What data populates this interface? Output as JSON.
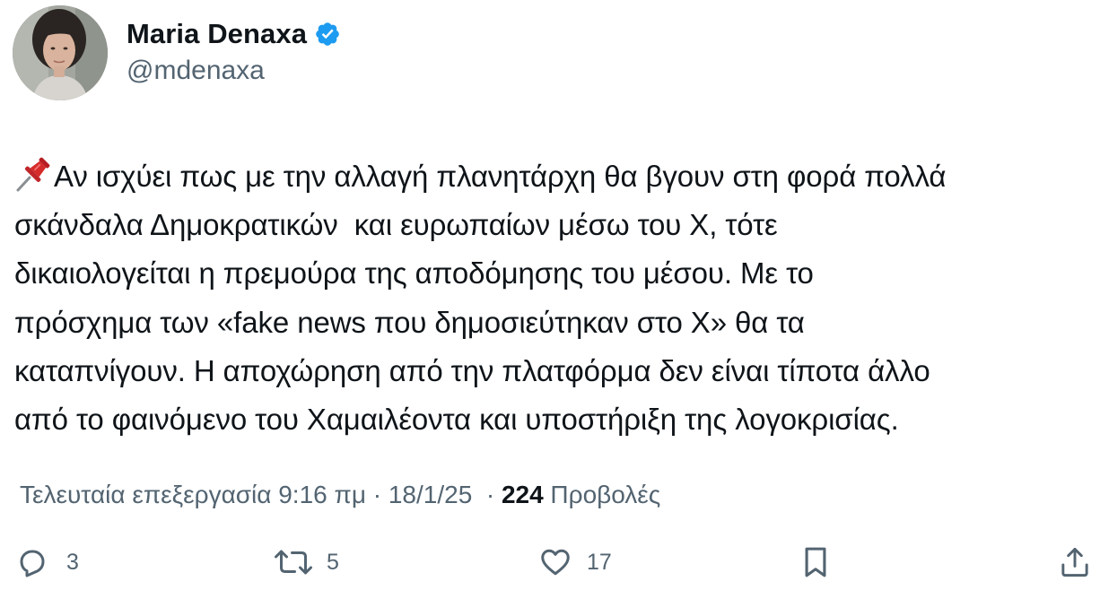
{
  "author": {
    "display_name": "Maria Denaxa",
    "handle": "@mdenaxa",
    "verified_color": "#1d9bf0"
  },
  "tweet": {
    "pin_icon": "pushpin-icon",
    "text": "Αν ισχύει πως με την αλλαγή πλανητάρχη θα βγουν στη φορά πολλά σκάνδαλα Δημοκρατικών  και ευρωπαίων μέσω του Χ, τότε δικαιολογείται η πρεμούρα της αποδόμησης του μέσου. Με το πρόσχημα των «fake news που δημοσιεύτηκαν στο Χ» θα τα καταπνίγουν. Η αποχώρηση από την πλατφόρμα δεν είναι τίποτα άλλο από το φαινόμενο του Χαμαιλέοντα και υποστήριξη της λογοκρισίας.",
    "lines": [
      "Αν ισχύει πως με την αλλαγή πλανητάρχη θα βγουν στη φορά πολλά",
      "σκάνδαλα Δημοκρατικών  και ευρωπαίων μέσω του Χ, τότε",
      "δικαιολογείται η πρεμούρα της αποδόμησης του μέσου. Με το",
      "πρόσχημα των «fake news που δημοσιεύτηκαν στο Χ» θα τα",
      "καταπνίγουν. Η αποχώρηση από την πλατφόρμα δεν είναι τίποτα άλλο",
      "από το φαινόμενο του Χαμαιλέοντα και υποστήριξη της λογοκρισίας."
    ]
  },
  "meta": {
    "edited_label": "Τελευταία επεξεργασία 9:16 πμ · 18/1/25 ",
    "separator": " · ",
    "views_count": "224",
    "views_label": " Προβολές"
  },
  "actions": {
    "replies": "3",
    "reposts": "5",
    "likes": "17",
    "icons": [
      "reply-icon",
      "repost-icon",
      "like-icon",
      "bookmark-icon",
      "share-icon"
    ]
  },
  "colors": {
    "text": "#0f1419",
    "secondary": "#536471",
    "verified": "#1d9bf0",
    "pin_red": "#d62b2b"
  }
}
